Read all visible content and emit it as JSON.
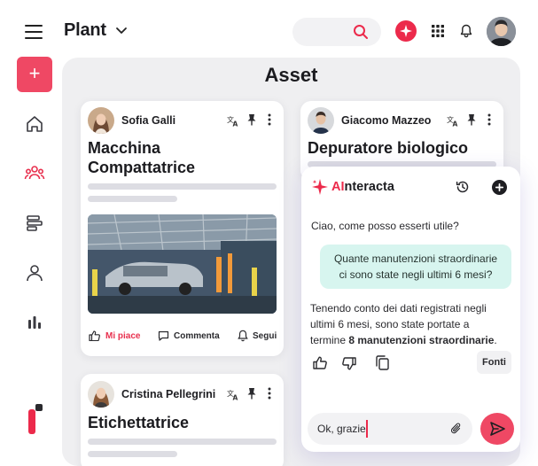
{
  "header": {
    "title": "Plant",
    "colors": {
      "accent": "#ec2a4b",
      "panel_bg": "#efeff1"
    }
  },
  "panel": {
    "title": "Asset"
  },
  "cards": [
    {
      "author": "Sofia Galli",
      "title_line1": "Macchina",
      "title_line2": "Compattatrice",
      "actions": {
        "like": "Mi piace",
        "comment": "Commenta",
        "follow": "Segui"
      }
    },
    {
      "author": "Giacomo Mazzeo",
      "title": "Depuratore biologico"
    },
    {
      "author": "Cristina Pellegrini",
      "title": "Etichettatrice"
    }
  ],
  "ai": {
    "title_highlight": "AI",
    "title_rest": "nteracta",
    "greeting": "Ciao, come posso esserti utile?",
    "user_message": "Quante manutenzioni straordinarie ci sono state negli ultimi 6 mesi?",
    "answer_pre": "Tenendo conto dei dati registrati negli ultimi 6 mesi, sono state portate a termine ",
    "answer_bold": "8 manutenzioni straordinarie",
    "answer_post": ".",
    "sources_label": "Fonti",
    "input_value": "Ok, grazie"
  }
}
